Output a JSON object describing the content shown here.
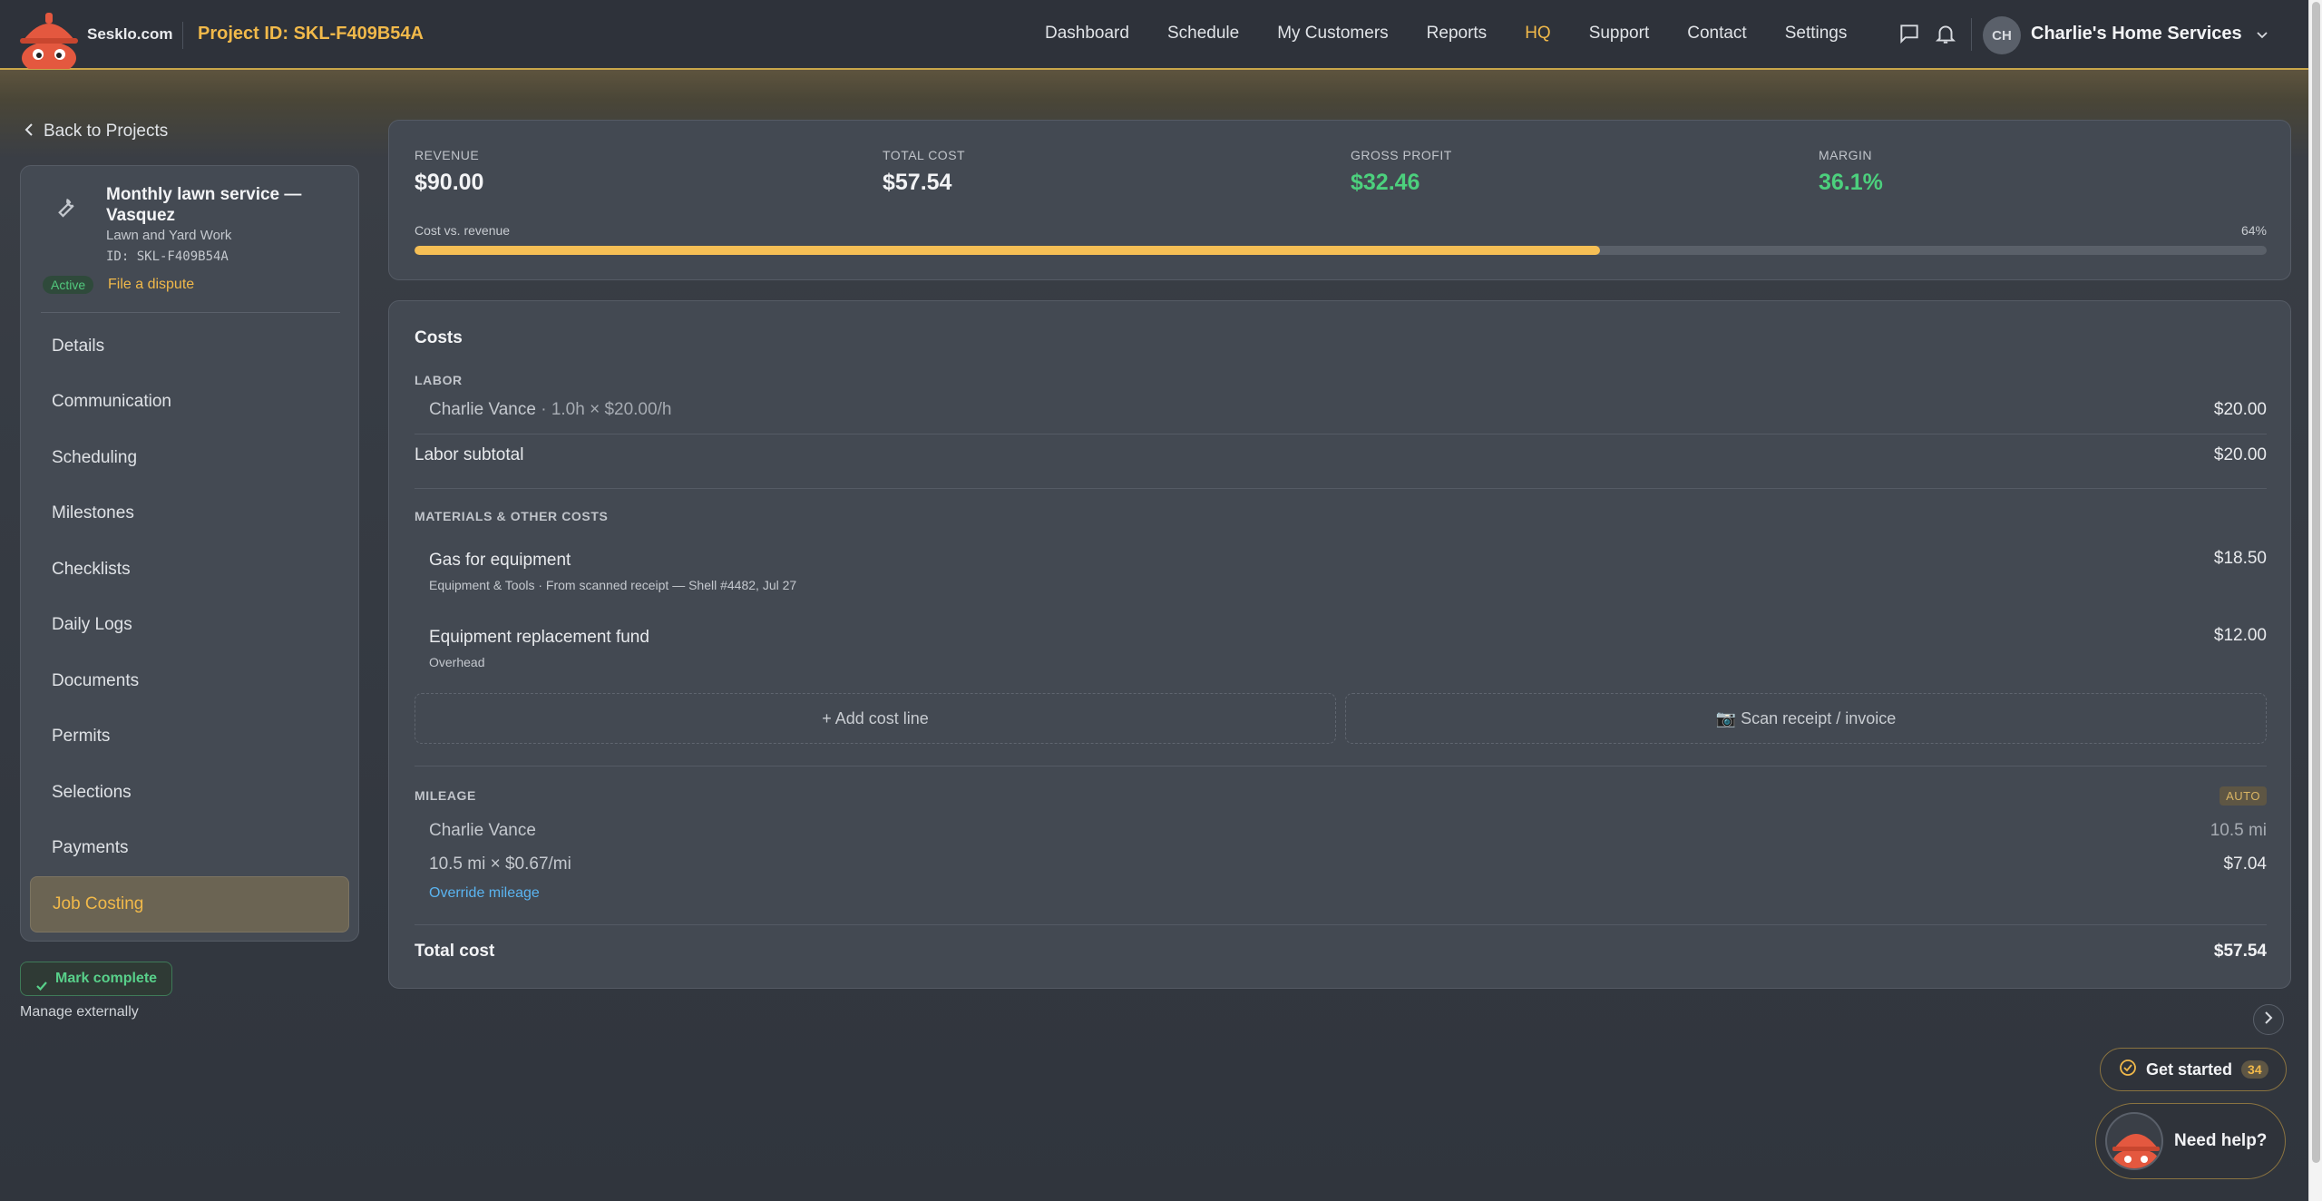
{
  "header": {
    "brand": "Sesklo.com",
    "project_id": "Project ID: SKL-F409B54A",
    "nav": [
      {
        "label": "Dashboard",
        "active": false
      },
      {
        "label": "Schedule",
        "active": false
      },
      {
        "label": "My Customers",
        "active": false
      },
      {
        "label": "Reports",
        "active": false
      },
      {
        "label": "HQ",
        "active": true
      },
      {
        "label": "Support",
        "active": false
      },
      {
        "label": "Contact",
        "active": false
      },
      {
        "label": "Settings",
        "active": false
      }
    ],
    "icons": [
      "chat-icon",
      "bell-icon"
    ],
    "avatar_initials": "CH",
    "company": "Charlie's Home Services",
    "accent": "#f1b94a"
  },
  "sidebar": {
    "back_label": "Back to Projects",
    "project": {
      "title": "Monthly lawn service — Vasquez",
      "category": "Lawn and Yard Work",
      "id": "ID: SKL-F409B54A",
      "status": "Active",
      "dispute_label": "File a dispute"
    },
    "items": [
      {
        "label": "Details"
      },
      {
        "label": "Communication"
      },
      {
        "label": "Scheduling"
      },
      {
        "label": "Milestones"
      },
      {
        "label": "Checklists"
      },
      {
        "label": "Daily Logs"
      },
      {
        "label": "Documents"
      },
      {
        "label": "Permits"
      },
      {
        "label": "Selections"
      },
      {
        "label": "Payments"
      },
      {
        "label": "Job Costing"
      }
    ],
    "active_item": "Job Costing",
    "mark_complete": "Mark complete",
    "manage_externally": "Manage externally"
  },
  "summary": {
    "revenue_label": "REVENUE",
    "revenue": "$90.00",
    "total_cost_label": "TOTAL COST",
    "total_cost": "$57.54",
    "gross_profit_label": "GROSS PROFIT",
    "gross_profit": "$32.46",
    "margin_label": "MARGIN",
    "margin": "36.1%",
    "cost_vs_revenue_label": "Cost vs. revenue",
    "cost_vs_revenue_pct": "64%",
    "cost_vs_revenue_fraction": 0.64
  },
  "costs": {
    "title": "Costs",
    "labor_label": "LABOR",
    "labor_name": "Charlie Vance",
    "labor_detail": " · 1.0h × $20.00/h",
    "labor_amount": "$20.00",
    "labor_subtotal_label": "Labor subtotal",
    "labor_subtotal": "$20.00",
    "materials_label": "MATERIALS & OTHER COSTS",
    "materials": [
      {
        "name": "Gas for equipment",
        "sub": "Equipment & Tools · From scanned receipt — Shell #4482, Jul 27",
        "amount": "$18.50"
      },
      {
        "name": "Equipment replacement fund",
        "sub": "Overhead",
        "amount": "$12.00"
      }
    ],
    "add_cost_line": "+ Add cost line",
    "scan_receipt": "📷 Scan receipt / invoice",
    "mileage_label": "MILEAGE",
    "mileage_badge": "AUTO",
    "mileage_name": "Charlie Vance",
    "mileage_distance": "10.5 mi",
    "mileage_calc": "10.5 mi × $0.67/mi",
    "mileage_amount": "$7.04",
    "override_label": "Override mileage",
    "total_label": "Total cost",
    "total_amount": "$57.54"
  },
  "floating": {
    "get_started": "Get started",
    "get_started_count": "34",
    "need_help": "Need help?"
  }
}
